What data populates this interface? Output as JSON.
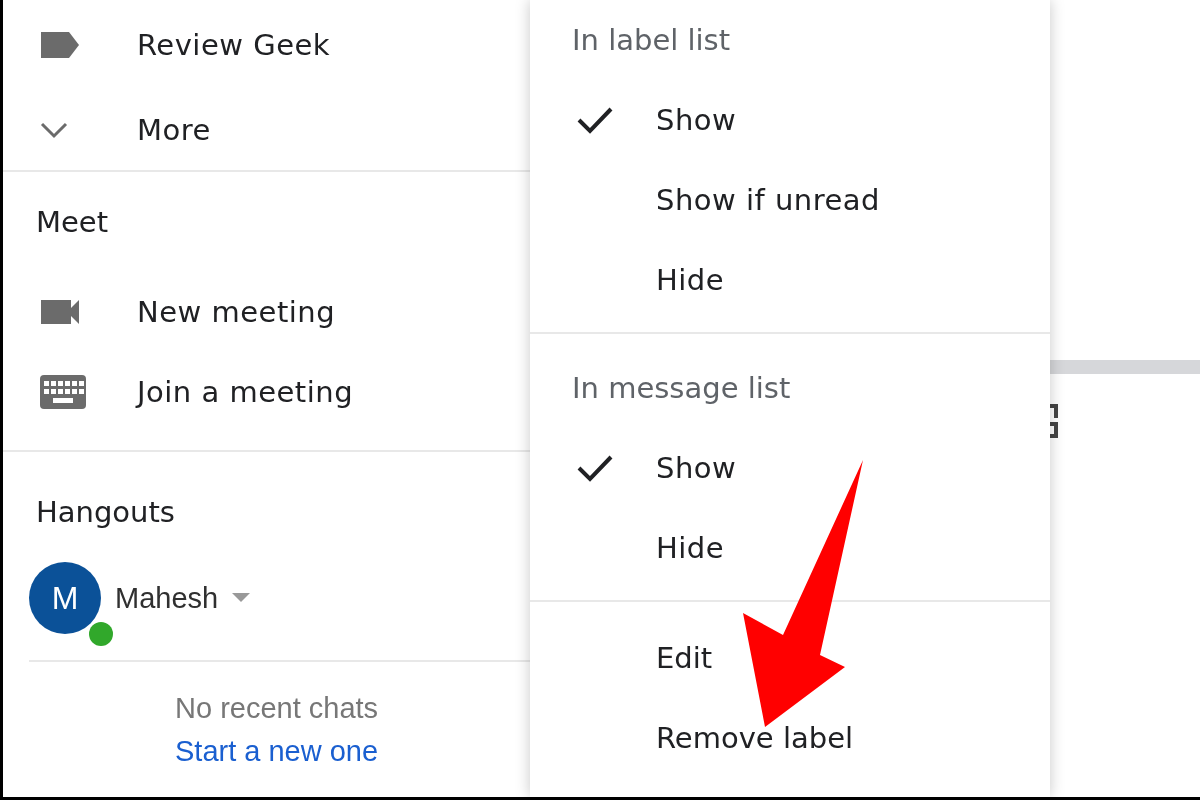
{
  "sidebar": {
    "labels": [
      {
        "kind": "label",
        "text": "Review Geek"
      },
      {
        "kind": "more",
        "text": "More"
      }
    ],
    "meet": {
      "title": "Meet",
      "items": [
        {
          "kind": "video",
          "text": "New meeting"
        },
        {
          "kind": "keyboard",
          "text": "Join a meeting"
        }
      ]
    },
    "hangouts": {
      "title": "Hangouts",
      "user": {
        "initial": "M",
        "name": "Mahesh",
        "online": true
      },
      "empty_text": "No recent chats",
      "link": "Start a new one"
    }
  },
  "menu": {
    "sections": [
      {
        "title": "In label list",
        "options": [
          {
            "text": "Show",
            "selected": true
          },
          {
            "text": "Show if unread",
            "selected": false
          },
          {
            "text": "Hide",
            "selected": false
          }
        ]
      },
      {
        "title": "In message list",
        "options": [
          {
            "text": "Show",
            "selected": true
          },
          {
            "text": "Hide",
            "selected": false
          }
        ]
      }
    ],
    "actions": [
      "Edit",
      "Remove label"
    ]
  }
}
